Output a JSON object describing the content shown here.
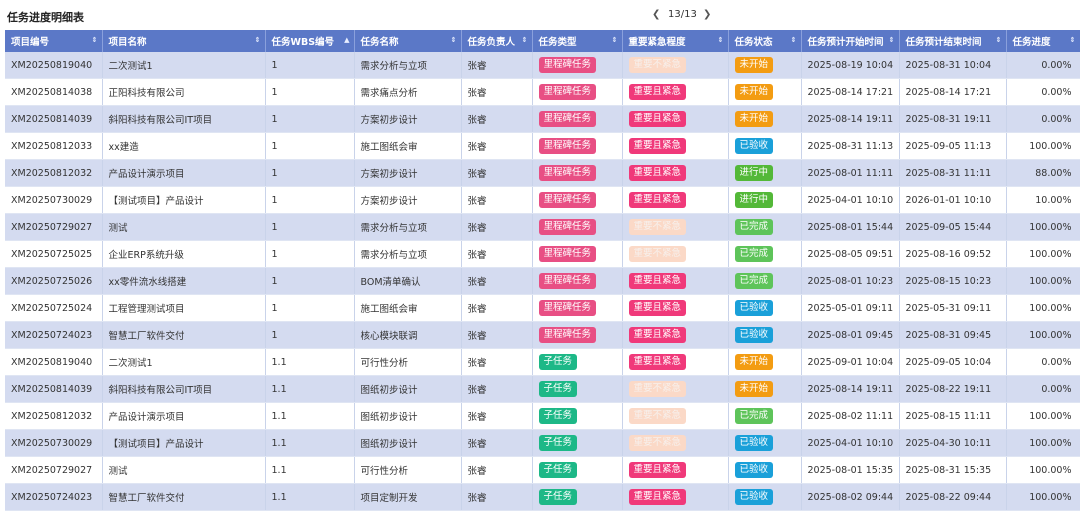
{
  "header": {
    "title": "任务进度明细表",
    "page_text": "13/13"
  },
  "columns": [
    "项目编号",
    "项目名称",
    "任务WBS编号",
    "任务名称",
    "任务负责人",
    "任务类型",
    "重要紧急程度",
    "任务状态",
    "任务预计开始时间",
    "任务预计结束时间",
    "任务进度"
  ],
  "rows": [
    [
      "XM20250819040",
      "二次测试1",
      "1",
      "需求分析与立项",
      "张睿",
      "里程碑任务",
      "重要不紧急",
      "未开始",
      "2025-08-19 10:04",
      "2025-08-31 10:04",
      "0.00%"
    ],
    [
      "XM20250814038",
      "正阳科技有限公司",
      "1",
      "需求痛点分析",
      "张睿",
      "里程碑任务",
      "重要且紧急",
      "未开始",
      "2025-08-14 17:21",
      "2025-08-14 17:21",
      "0.00%"
    ],
    [
      "XM20250814039",
      "斜阳科技有限公司IT项目",
      "1",
      "方案初步设计",
      "张睿",
      "里程碑任务",
      "重要且紧急",
      "未开始",
      "2025-08-14 19:11",
      "2025-08-31 19:11",
      "0.00%"
    ],
    [
      "XM20250812033",
      "xx建造",
      "1",
      "施工图纸会审",
      "张睿",
      "里程碑任务",
      "重要且紧急",
      "已验收",
      "2025-08-31 11:13",
      "2025-09-05 11:13",
      "100.00%"
    ],
    [
      "XM20250812032",
      "产品设计演示项目",
      "1",
      "方案初步设计",
      "张睿",
      "里程碑任务",
      "重要且紧急",
      "进行中",
      "2025-08-01 11:11",
      "2025-08-31 11:11",
      "88.00%"
    ],
    [
      "XM20250730029",
      "【测试项目】产品设计",
      "1",
      "方案初步设计",
      "张睿",
      "里程碑任务",
      "重要且紧急",
      "进行中",
      "2025-04-01 10:10",
      "2026-01-01 10:10",
      "10.00%"
    ],
    [
      "XM20250729027",
      "测试",
      "1",
      "需求分析与立项",
      "张睿",
      "里程碑任务",
      "重要不紧急",
      "已完成",
      "2025-08-01 15:44",
      "2025-09-05 15:44",
      "100.00%"
    ],
    [
      "XM20250725025",
      "企业ERP系统升级",
      "1",
      "需求分析与立项",
      "张睿",
      "里程碑任务",
      "重要不紧急",
      "已完成",
      "2025-08-05 09:51",
      "2025-08-16 09:52",
      "100.00%"
    ],
    [
      "XM20250725026",
      "xx零件流水线搭建",
      "1",
      "BOM清单确认",
      "张睿",
      "里程碑任务",
      "重要且紧急",
      "已完成",
      "2025-08-01 10:23",
      "2025-08-15 10:23",
      "100.00%"
    ],
    [
      "XM20250725024",
      "工程管理测试项目",
      "1",
      "施工图纸会审",
      "张睿",
      "里程碑任务",
      "重要且紧急",
      "已验收",
      "2025-05-01 09:11",
      "2025-05-31 09:11",
      "100.00%"
    ],
    [
      "XM20250724023",
      "智慧工厂软件交付",
      "1",
      "核心模块联调",
      "张睿",
      "里程碑任务",
      "重要且紧急",
      "已验收",
      "2025-08-01 09:45",
      "2025-08-31 09:45",
      "100.00%"
    ],
    [
      "XM20250819040",
      "二次测试1",
      "1.1",
      "可行性分析",
      "张睿",
      "子任务",
      "重要且紧急",
      "未开始",
      "2025-09-01 10:04",
      "2025-09-05 10:04",
      "0.00%"
    ],
    [
      "XM20250814039",
      "斜阳科技有限公司IT项目",
      "1.1",
      "图纸初步设计",
      "张睿",
      "子任务",
      "重要不紧急",
      "未开始",
      "2025-08-14 19:11",
      "2025-08-22 19:11",
      "0.00%"
    ],
    [
      "XM20250812032",
      "产品设计演示项目",
      "1.1",
      "图纸初步设计",
      "张睿",
      "子任务",
      "重要不紧急",
      "已完成",
      "2025-08-02 11:11",
      "2025-08-15 11:11",
      "100.00%"
    ],
    [
      "XM20250730029",
      "【测试项目】产品设计",
      "1.1",
      "图纸初步设计",
      "张睿",
      "子任务",
      "重要不紧急",
      "已验收",
      "2025-04-01 10:10",
      "2025-04-30 10:11",
      "100.00%"
    ],
    [
      "XM20250729027",
      "测试",
      "1.1",
      "可行性分析",
      "张睿",
      "子任务",
      "重要且紧急",
      "已验收",
      "2025-08-01 15:35",
      "2025-08-31 15:35",
      "100.00%"
    ],
    [
      "XM20250724023",
      "智慧工厂软件交付",
      "1.1",
      "项目定制开发",
      "张睿",
      "子任务",
      "重要且紧急",
      "已验收",
      "2025-08-02 09:44",
      "2025-08-22 09:44",
      "100.00%"
    ]
  ]
}
